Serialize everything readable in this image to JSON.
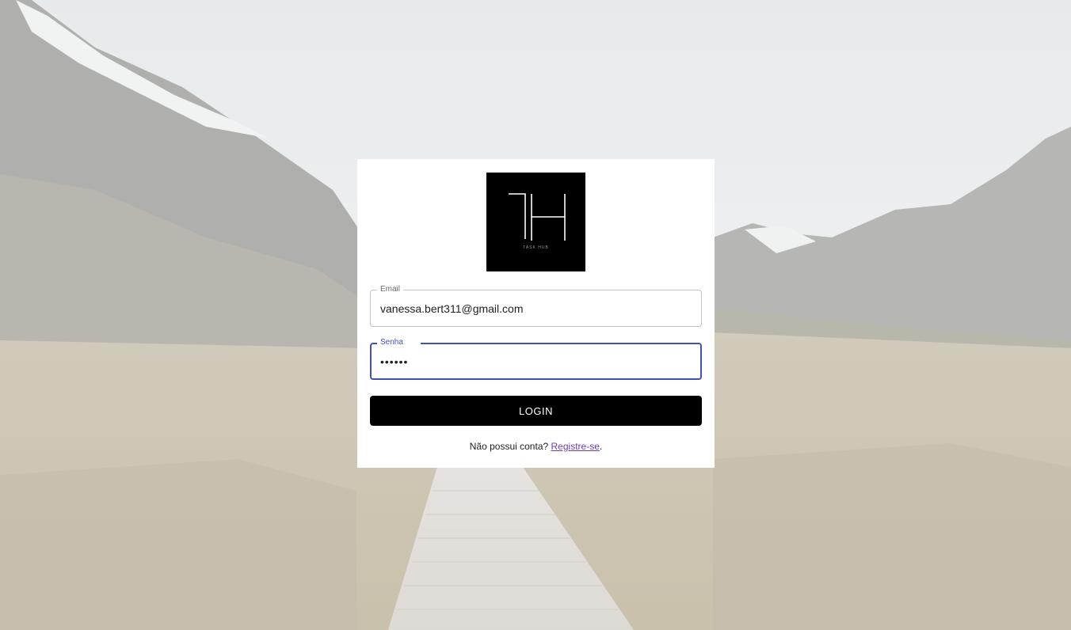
{
  "logo": {
    "monogram": "TH",
    "caption": "TASK HUB"
  },
  "form": {
    "email": {
      "label": "Email",
      "value": "vanessa.bert311@gmail.com"
    },
    "password": {
      "label": "Senha",
      "value": "••••••"
    },
    "login_label": "LOGIN"
  },
  "signup": {
    "prompt": "Não possui conta?",
    "link_label": "Registre-se",
    "suffix": "."
  },
  "colors": {
    "card": "#ffffff",
    "button": "#000000",
    "focus": "#3f51b5",
    "link": "#6a3fb5"
  }
}
